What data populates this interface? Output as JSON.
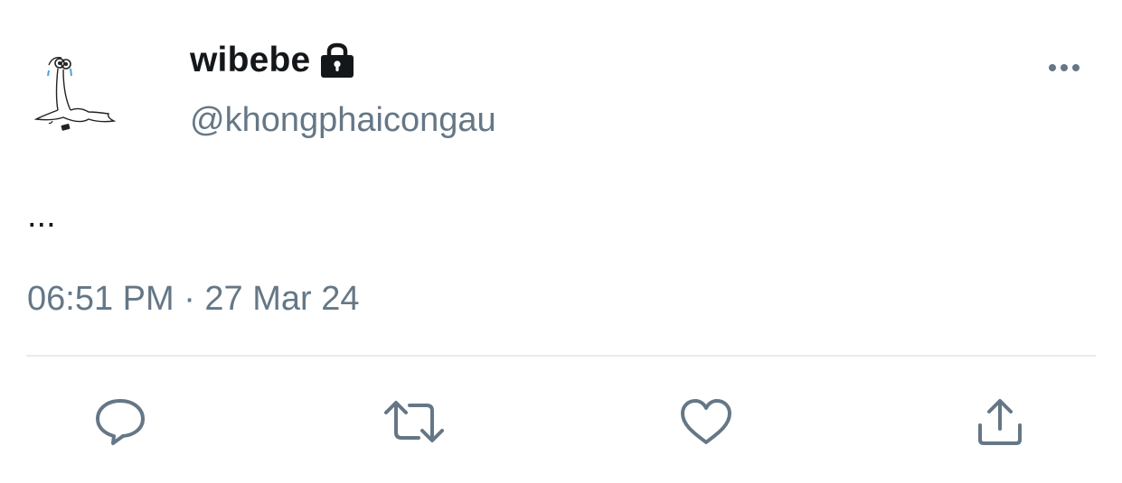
{
  "user": {
    "display_name": "wibebe",
    "handle": "@khongphaicongau",
    "protected_icon": "lock-icon",
    "avatar_icon": "sad-goose-drawing"
  },
  "tweet": {
    "text": "...",
    "timestamp": "06:51 PM · 27 Mar 24"
  },
  "actions": {
    "more": "more-options-icon",
    "reply": "reply-icon",
    "retweet": "retweet-icon",
    "like": "like-heart-icon",
    "share": "share-icon"
  },
  "colors": {
    "primary_text": "#14171a",
    "secondary_text": "#657786",
    "divider": "#e6ecf0",
    "icon": "#657786"
  }
}
